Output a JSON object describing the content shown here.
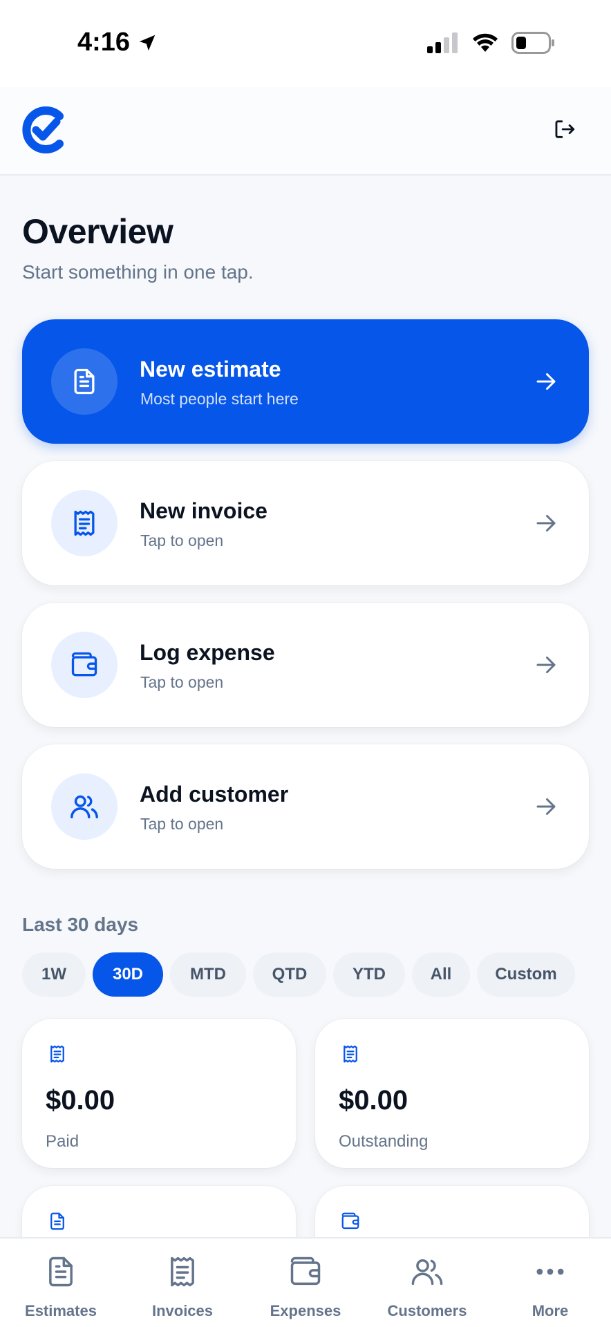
{
  "status_bar": {
    "time": "4:16"
  },
  "header": {
    "logo": "check-logo",
    "logout_icon": "logout-icon"
  },
  "page": {
    "title": "Overview",
    "subtitle": "Start something in one tap."
  },
  "actions": [
    {
      "title": "New estimate",
      "subtitle": "Most people start here",
      "icon": "document-icon"
    },
    {
      "title": "New invoice",
      "subtitle": "Tap to open",
      "icon": "receipt-icon"
    },
    {
      "title": "Log expense",
      "subtitle": "Tap to open",
      "icon": "wallet-icon"
    },
    {
      "title": "Add customer",
      "subtitle": "Tap to open",
      "icon": "users-icon"
    }
  ],
  "range": {
    "label": "Last 30 days",
    "chips": [
      "1W",
      "30D",
      "MTD",
      "QTD",
      "YTD",
      "All",
      "Custom"
    ],
    "selected": "30D"
  },
  "stats": [
    {
      "value": "$0.00",
      "label": "Paid",
      "icon": "receipt-icon"
    },
    {
      "value": "$0.00",
      "label": "Outstanding",
      "icon": "receipt-icon"
    },
    {
      "icon": "document-icon"
    },
    {
      "icon": "wallet-icon"
    }
  ],
  "tabs": [
    {
      "label": "Estimates",
      "icon": "document-icon"
    },
    {
      "label": "Invoices",
      "icon": "receipt-icon"
    },
    {
      "label": "Expenses",
      "icon": "wallet-icon"
    },
    {
      "label": "Customers",
      "icon": "users-icon"
    },
    {
      "label": "More",
      "icon": "more-icon"
    }
  ],
  "colors": {
    "accent": "#0656ea",
    "icon_bg": "#e8f0ff",
    "muted": "#64748b"
  }
}
